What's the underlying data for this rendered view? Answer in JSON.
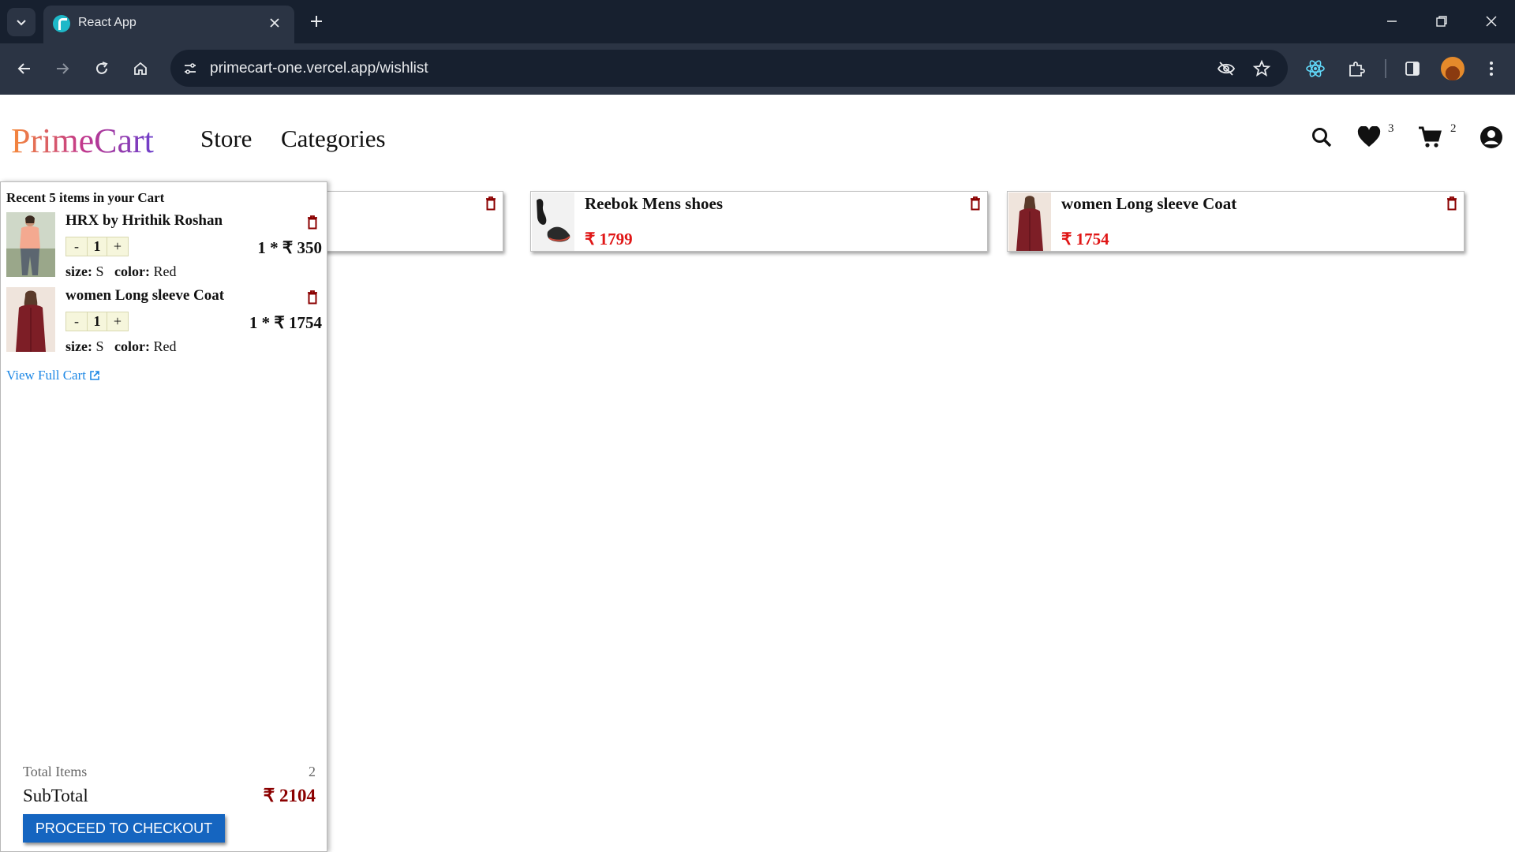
{
  "browser": {
    "tab_title": "React App",
    "url": "primecart-one.vercel.app/wishlist"
  },
  "header": {
    "logo": "PrimeCart",
    "nav": [
      "Store",
      "Categories"
    ],
    "wishlist_count": "3",
    "cart_count": "2",
    "logo_gradient": [
      "#f5893a",
      "#c2388c",
      "#6d3fcb"
    ]
  },
  "wishlist": {
    "items": [
      {
        "name": "Reebok Mens shoes",
        "price": "₹ 1799",
        "image_icon": "black-sneaker-image"
      },
      {
        "name": "women Long sleeve Coat",
        "price": "₹ 1754",
        "image_icon": "maroon-coat-model-image"
      }
    ],
    "price_color": "#e01616"
  },
  "cart_preview": {
    "heading": "Recent 5 items in your Cart",
    "items": [
      {
        "name": "HRX by Hrithik Roshan",
        "minus": "-",
        "qty": "1",
        "plus": "+",
        "price": "1 * ₹ 350",
        "size_label": "size:",
        "size": "S",
        "color_label": "color:",
        "color": "Red",
        "image_icon": "peach-top-model-image"
      },
      {
        "name": "women Long sleeve Coat",
        "minus": "-",
        "qty": "1",
        "plus": "+",
        "price": "1 * ₹ 1754",
        "size_label": "size:",
        "size": "S",
        "color_label": "color:",
        "color": "Red",
        "image_icon": "maroon-coat-model-image"
      }
    ],
    "view_full_cart": "View Full Cart",
    "total_items_label": "Total Items",
    "total_items_value": "2",
    "subtotal_label": "SubTotal",
    "subtotal_value": "₹ 2104",
    "checkout_label": "PROCEED TO CHECKOUT",
    "checkout_color": "#1565c0",
    "subtotal_color": "#8b0000"
  }
}
